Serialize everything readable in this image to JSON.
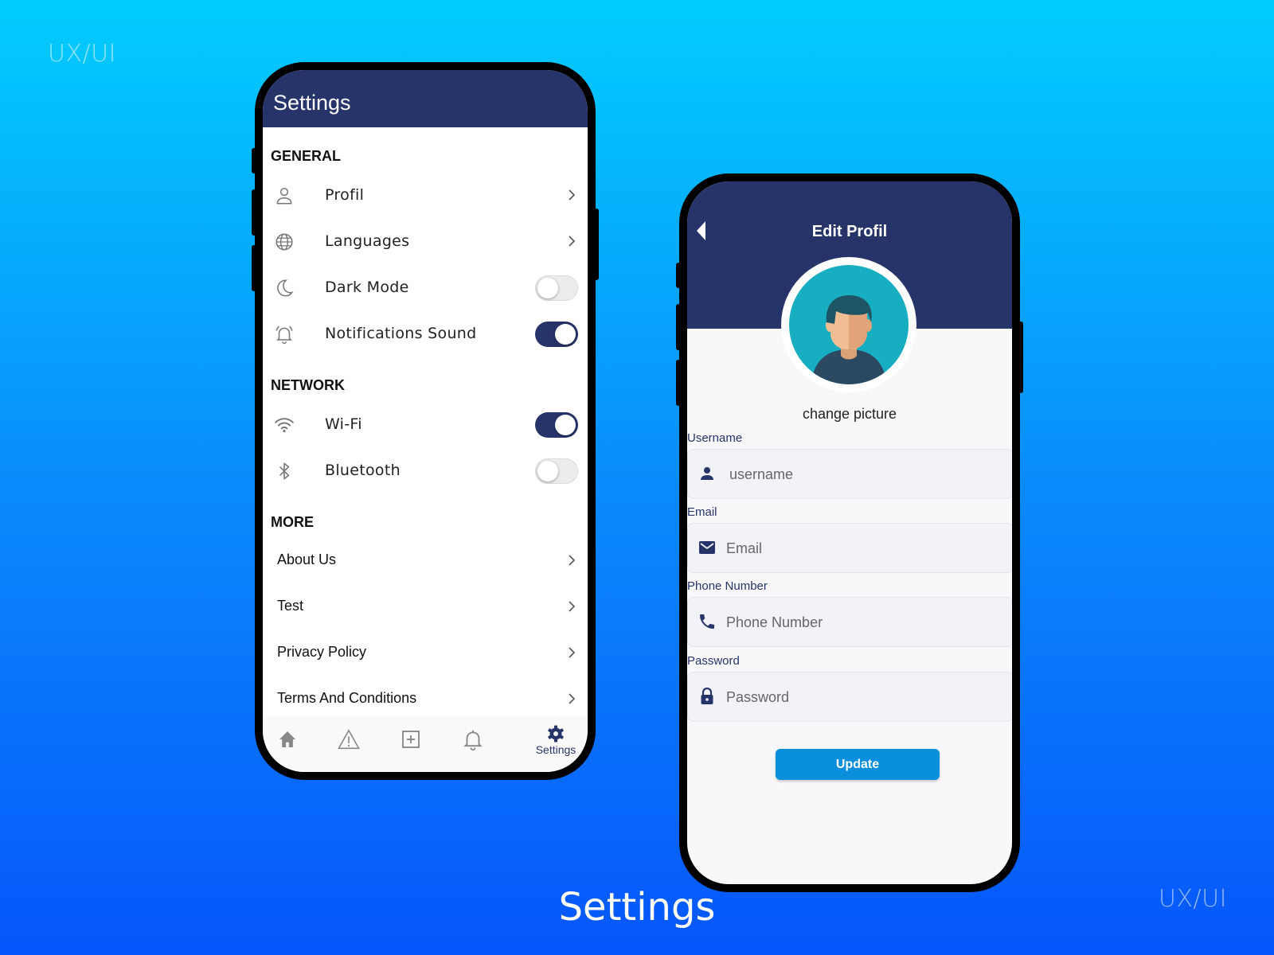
{
  "watermark_text": "UX/UI",
  "caption": "Settings",
  "settings_screen": {
    "title": "Settings",
    "sections": {
      "general": "GENERAL",
      "network": "NETWORK",
      "more": "MORE"
    },
    "general_items": [
      {
        "label": "Profil",
        "icon": "person-icon",
        "control": "chevron"
      },
      {
        "label": "Languages",
        "icon": "globe-icon",
        "control": "chevron"
      },
      {
        "label": "Dark Mode",
        "icon": "moon-icon",
        "control": "toggle",
        "on": false
      },
      {
        "label": "Notifications Sound",
        "icon": "alarm-bell-icon",
        "control": "toggle",
        "on": true
      }
    ],
    "network_items": [
      {
        "label": "Wi-Fi",
        "icon": "wifi-icon",
        "control": "toggle",
        "on": true
      },
      {
        "label": "Bluetooth",
        "icon": "bluetooth-icon",
        "control": "toggle",
        "on": false
      }
    ],
    "more_items": [
      {
        "label": "About Us"
      },
      {
        "label": "Test"
      },
      {
        "label": "Privacy Policy"
      },
      {
        "label": "Terms And Conditions"
      }
    ],
    "bottom_nav": {
      "items": [
        "home-icon",
        "warning-icon",
        "add-box-icon",
        "bell-icon",
        "gear-icon"
      ],
      "active_label": "Settings"
    }
  },
  "edit_profile_screen": {
    "title": "Edit Profil",
    "change_picture": "change picture",
    "fields": {
      "username": {
        "label": "Username",
        "placeholder": "username",
        "icon": "person-icon"
      },
      "email": {
        "label": "Email",
        "placeholder": "Email",
        "icon": "mail-icon"
      },
      "phone": {
        "label": "Phone Number",
        "placeholder": "Phone Number",
        "icon": "phone-icon"
      },
      "password": {
        "label": "Password",
        "placeholder": "Password",
        "icon": "lock-icon"
      }
    },
    "update_label": "Update"
  },
  "colors": {
    "header_navy": "#27346a",
    "accent_blue": "#0a8fdc",
    "avatar_teal": "#18aec2"
  }
}
